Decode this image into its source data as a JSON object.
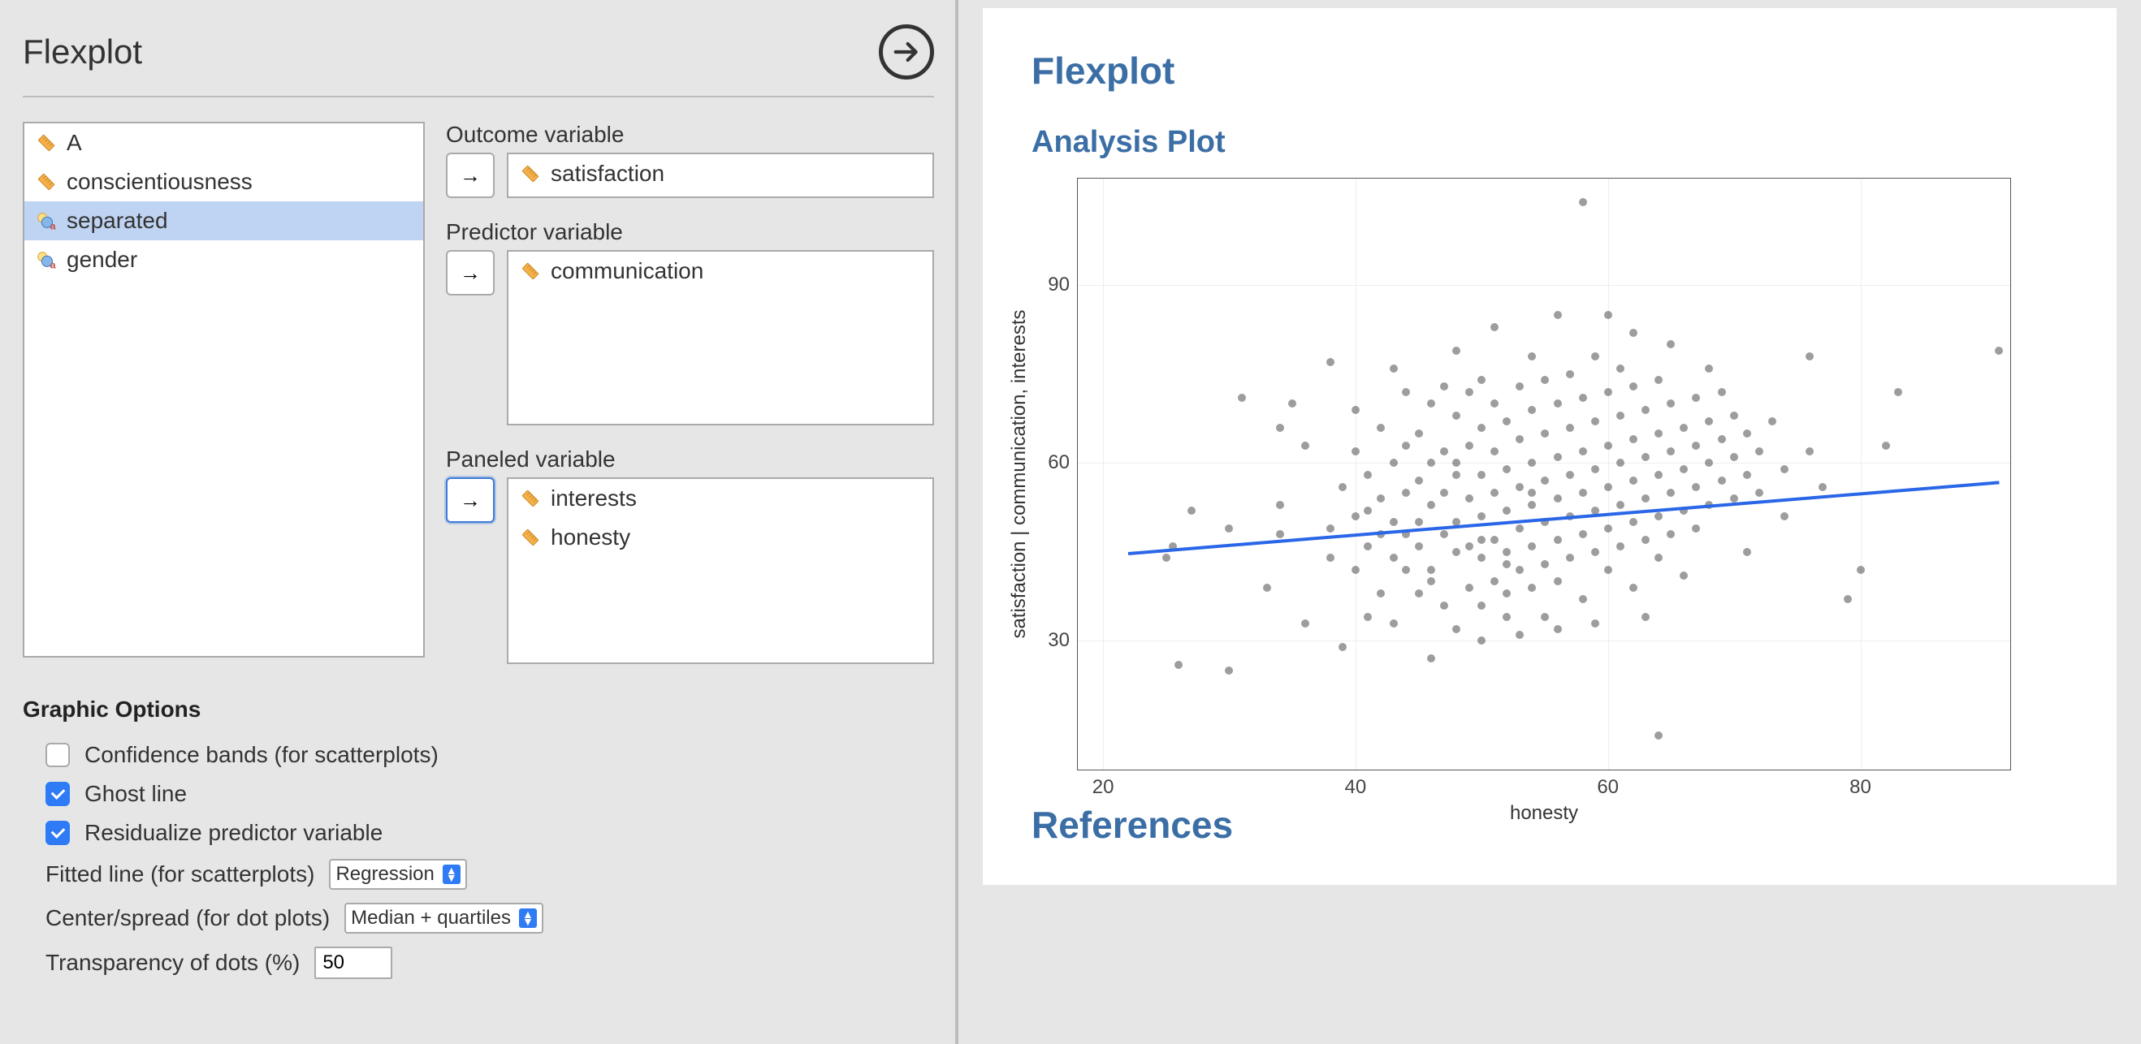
{
  "title": "Flexplot",
  "variables": [
    {
      "name": "A",
      "type": "scale",
      "selected": false
    },
    {
      "name": "conscientiousness",
      "type": "scale",
      "selected": false
    },
    {
      "name": "separated",
      "type": "nominal",
      "selected": true
    },
    {
      "name": "gender",
      "type": "nominal",
      "selected": false
    }
  ],
  "assign": {
    "outcome": {
      "label": "Outcome variable",
      "items": [
        {
          "name": "satisfaction",
          "type": "scale"
        }
      ]
    },
    "predictor": {
      "label": "Predictor variable",
      "items": [
        {
          "name": "communication",
          "type": "scale"
        }
      ]
    },
    "panel": {
      "label": "Paneled variable",
      "items": [
        {
          "name": "interests",
          "type": "scale"
        },
        {
          "name": "honesty",
          "type": "scale"
        }
      ]
    }
  },
  "options": {
    "title": "Graphic Options",
    "conf_bands": {
      "label": "Confidence bands (for scatterplots)",
      "checked": false
    },
    "ghost": {
      "label": "Ghost line",
      "checked": true
    },
    "resid": {
      "label": "Residualize predictor variable",
      "checked": true
    },
    "fitted": {
      "label": "Fitted line (for scatterplots)",
      "value": "Regression"
    },
    "center": {
      "label": "Center/spread (for dot plots)",
      "value": "Median + quartiles"
    },
    "alpha": {
      "label": "Transparency of dots (%)",
      "value": "50"
    }
  },
  "output": {
    "title": "Flexplot",
    "subtitle": "Analysis Plot",
    "refs": "References"
  },
  "chart_data": {
    "type": "scatter",
    "xlabel": "honesty",
    "ylabel": "satisfaction | communication, interests",
    "xlim": [
      18,
      92
    ],
    "ylim": [
      8,
      108
    ],
    "xticks": [
      20,
      40,
      60,
      80
    ],
    "yticks": [
      30,
      60,
      90
    ],
    "fit": {
      "x1": 22,
      "y1": 45,
      "x2": 91,
      "y2": 57
    },
    "points": [
      [
        25,
        44
      ],
      [
        25.5,
        46
      ],
      [
        26,
        26
      ],
      [
        27,
        52
      ],
      [
        30,
        25
      ],
      [
        30,
        49
      ],
      [
        31,
        71
      ],
      [
        33,
        39
      ],
      [
        34,
        53
      ],
      [
        34,
        66
      ],
      [
        34,
        48
      ],
      [
        35,
        70
      ],
      [
        36,
        33
      ],
      [
        36,
        63
      ],
      [
        38,
        44
      ],
      [
        38,
        77
      ],
      [
        38,
        49
      ],
      [
        39,
        56
      ],
      [
        39,
        29
      ],
      [
        40,
        42
      ],
      [
        40,
        51
      ],
      [
        40,
        62
      ],
      [
        40,
        69
      ],
      [
        41,
        46
      ],
      [
        41,
        34
      ],
      [
        41,
        52
      ],
      [
        41,
        58
      ],
      [
        42,
        38
      ],
      [
        42,
        66
      ],
      [
        42,
        48
      ],
      [
        42,
        54
      ],
      [
        43,
        76
      ],
      [
        43,
        44
      ],
      [
        43,
        50
      ],
      [
        43,
        60
      ],
      [
        43,
        33
      ],
      [
        44,
        72
      ],
      [
        44,
        42
      ],
      [
        44,
        55
      ],
      [
        44,
        48
      ],
      [
        44,
        63
      ],
      [
        45,
        38
      ],
      [
        45,
        57
      ],
      [
        45,
        50
      ],
      [
        45,
        65
      ],
      [
        45,
        46
      ],
      [
        46,
        53
      ],
      [
        46,
        60
      ],
      [
        46,
        42
      ],
      [
        46,
        70
      ],
      [
        46,
        27
      ],
      [
        47,
        73
      ],
      [
        47,
        48
      ],
      [
        47,
        55
      ],
      [
        47,
        62
      ],
      [
        47,
        36
      ],
      [
        48,
        45
      ],
      [
        48,
        58
      ],
      [
        48,
        50
      ],
      [
        48,
        68
      ],
      [
        48,
        32
      ],
      [
        48,
        79
      ],
      [
        49,
        54
      ],
      [
        49,
        46
      ],
      [
        49,
        63
      ],
      [
        49,
        39
      ],
      [
        49,
        72
      ],
      [
        50,
        51
      ],
      [
        50,
        58
      ],
      [
        50,
        44
      ],
      [
        50,
        66
      ],
      [
        50,
        36
      ],
      [
        50,
        74
      ],
      [
        50,
        30
      ],
      [
        51,
        55
      ],
      [
        51,
        47
      ],
      [
        51,
        62
      ],
      [
        51,
        40
      ],
      [
        51,
        70
      ],
      [
        51,
        83
      ],
      [
        52,
        52
      ],
      [
        52,
        59
      ],
      [
        52,
        45
      ],
      [
        52,
        67
      ],
      [
        52,
        38
      ],
      [
        52,
        34
      ],
      [
        53,
        56
      ],
      [
        53,
        49
      ],
      [
        53,
        64
      ],
      [
        53,
        42
      ],
      [
        53,
        73
      ],
      [
        53,
        31
      ],
      [
        54,
        53
      ],
      [
        54,
        60
      ],
      [
        54,
        46
      ],
      [
        54,
        69
      ],
      [
        54,
        39
      ],
      [
        54,
        78
      ],
      [
        55,
        57
      ],
      [
        55,
        50
      ],
      [
        55,
        65
      ],
      [
        55,
        43
      ],
      [
        55,
        34
      ],
      [
        55,
        74
      ],
      [
        56,
        54
      ],
      [
        56,
        61
      ],
      [
        56,
        47
      ],
      [
        56,
        70
      ],
      [
        56,
        40
      ],
      [
        56,
        85
      ],
      [
        56,
        32
      ],
      [
        57,
        58
      ],
      [
        57,
        51
      ],
      [
        57,
        66
      ],
      [
        57,
        44
      ],
      [
        57,
        75
      ],
      [
        58,
        55
      ],
      [
        58,
        62
      ],
      [
        58,
        48
      ],
      [
        58,
        71
      ],
      [
        58,
        37
      ],
      [
        58,
        104
      ],
      [
        59,
        59
      ],
      [
        59,
        52
      ],
      [
        59,
        67
      ],
      [
        59,
        45
      ],
      [
        59,
        78
      ],
      [
        59,
        33
      ],
      [
        60,
        56
      ],
      [
        60,
        63
      ],
      [
        60,
        49
      ],
      [
        60,
        72
      ],
      [
        60,
        42
      ],
      [
        60,
        85
      ],
      [
        61,
        60
      ],
      [
        61,
        53
      ],
      [
        61,
        68
      ],
      [
        61,
        46
      ],
      [
        61,
        76
      ],
      [
        62,
        57
      ],
      [
        62,
        64
      ],
      [
        62,
        50
      ],
      [
        62,
        73
      ],
      [
        62,
        39
      ],
      [
        62,
        82
      ],
      [
        63,
        61
      ],
      [
        63,
        54
      ],
      [
        63,
        69
      ],
      [
        63,
        47
      ],
      [
        63,
        34
      ],
      [
        64,
        58
      ],
      [
        64,
        65
      ],
      [
        64,
        51
      ],
      [
        64,
        74
      ],
      [
        64,
        44
      ],
      [
        64,
        14
      ],
      [
        65,
        62
      ],
      [
        65,
        55
      ],
      [
        65,
        70
      ],
      [
        65,
        48
      ],
      [
        65,
        80
      ],
      [
        66,
        59
      ],
      [
        66,
        66
      ],
      [
        66,
        52
      ],
      [
        66,
        41
      ],
      [
        67,
        63
      ],
      [
        67,
        56
      ],
      [
        67,
        71
      ],
      [
        67,
        49
      ],
      [
        68,
        60
      ],
      [
        68,
        67
      ],
      [
        68,
        53
      ],
      [
        68,
        76
      ],
      [
        69,
        64
      ],
      [
        69,
        57
      ],
      [
        69,
        72
      ],
      [
        70,
        61
      ],
      [
        70,
        68
      ],
      [
        70,
        54
      ],
      [
        71,
        65
      ],
      [
        71,
        58
      ],
      [
        71,
        45
      ],
      [
        72,
        62
      ],
      [
        72,
        55
      ],
      [
        73,
        67
      ],
      [
        74,
        59
      ],
      [
        74,
        51
      ],
      [
        76,
        62
      ],
      [
        76,
        78
      ],
      [
        77,
        56
      ],
      [
        79,
        37
      ],
      [
        80,
        42
      ],
      [
        82,
        63
      ],
      [
        83,
        72
      ],
      [
        91,
        79
      ],
      [
        50,
        47
      ],
      [
        48,
        60
      ],
      [
        46,
        40
      ],
      [
        52,
        43
      ],
      [
        54,
        55
      ]
    ]
  }
}
